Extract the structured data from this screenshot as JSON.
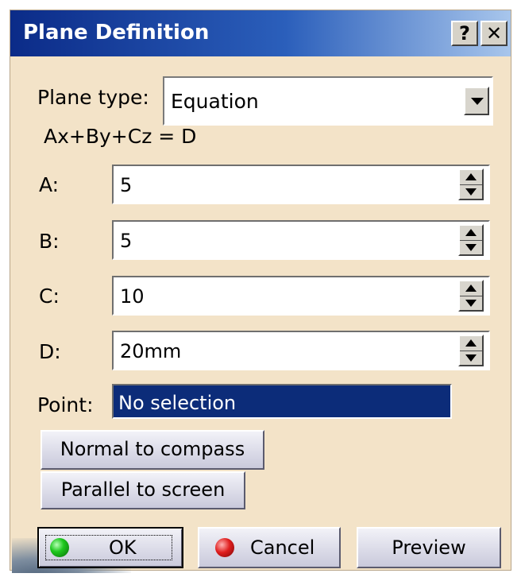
{
  "window": {
    "title": "Plane Definition",
    "help_label": "?",
    "close_label": "✕"
  },
  "plane_type": {
    "label": "Plane type:",
    "value": "Equation"
  },
  "equation": "Ax+By+Cz = D",
  "fields": [
    {
      "label": "A:",
      "value": "5"
    },
    {
      "label": "B:",
      "value": "5"
    },
    {
      "label": "C:",
      "value": "10"
    },
    {
      "label": "D:",
      "value": "20mm"
    }
  ],
  "point": {
    "label": "Point:",
    "value": "No selection"
  },
  "buttons": {
    "normal_to_compass": "Normal to compass",
    "parallel_to_screen": "Parallel to screen",
    "ok": "OK",
    "cancel": "Cancel",
    "preview": "Preview"
  },
  "icons": {
    "ok": "green-led-icon",
    "cancel": "red-led-icon",
    "dropdown": "chevron-down-icon",
    "spinner": "spinner-arrows-icon"
  },
  "colors": {
    "titlebar": "#0b2b88",
    "dialog_bg": "#f3e3c8",
    "selection_bg": "#0c2c79"
  }
}
